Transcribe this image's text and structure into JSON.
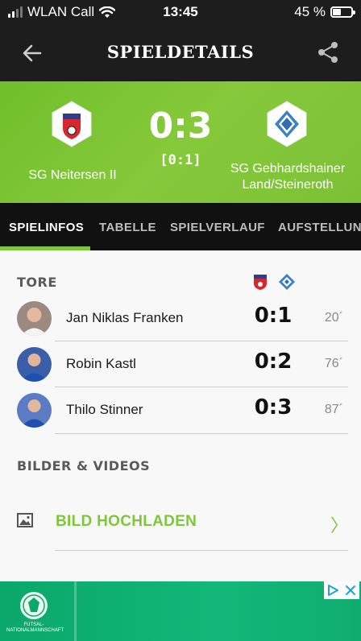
{
  "status_bar": {
    "carrier": "WLAN Call",
    "time": "13:45",
    "battery": "45 %",
    "battery_level": 0.45
  },
  "header": {
    "title": "SPIELDETAILS"
  },
  "match": {
    "score": "0:3",
    "halftime": "[0:1]",
    "home_team": "SG Neitersen II",
    "away_team_line1": "SG Gebhardshainer",
    "away_team_line2": "Land/Steineroth"
  },
  "tabs": [
    {
      "label": "SPIELINFOS",
      "active": true
    },
    {
      "label": "TABELLE",
      "active": false
    },
    {
      "label": "SPIELVERLAUF",
      "active": false
    },
    {
      "label": "AUFSTELLUNG",
      "active": false
    }
  ],
  "goals": {
    "title": "TORE",
    "rows": [
      {
        "player": "Jan Niklas Franken",
        "score": "0:1",
        "minute": "20´"
      },
      {
        "player": "Robin Kastl",
        "score": "0:2",
        "minute": "76´"
      },
      {
        "player": "Thilo Stinner",
        "score": "0:3",
        "minute": "87´"
      }
    ]
  },
  "media": {
    "title": "BILDER & VIDEOS",
    "upload_label": "BILD HOCHLADEN",
    "chevron": "〉"
  },
  "ad": {
    "logo_text": "FUTSAL-NATIONALMANNSCHAFT"
  },
  "colors": {
    "accent": "#7ec63b",
    "header_bg": "#1d1d1d",
    "banner_green": "#7cc036",
    "ad_green": "#12b778"
  }
}
